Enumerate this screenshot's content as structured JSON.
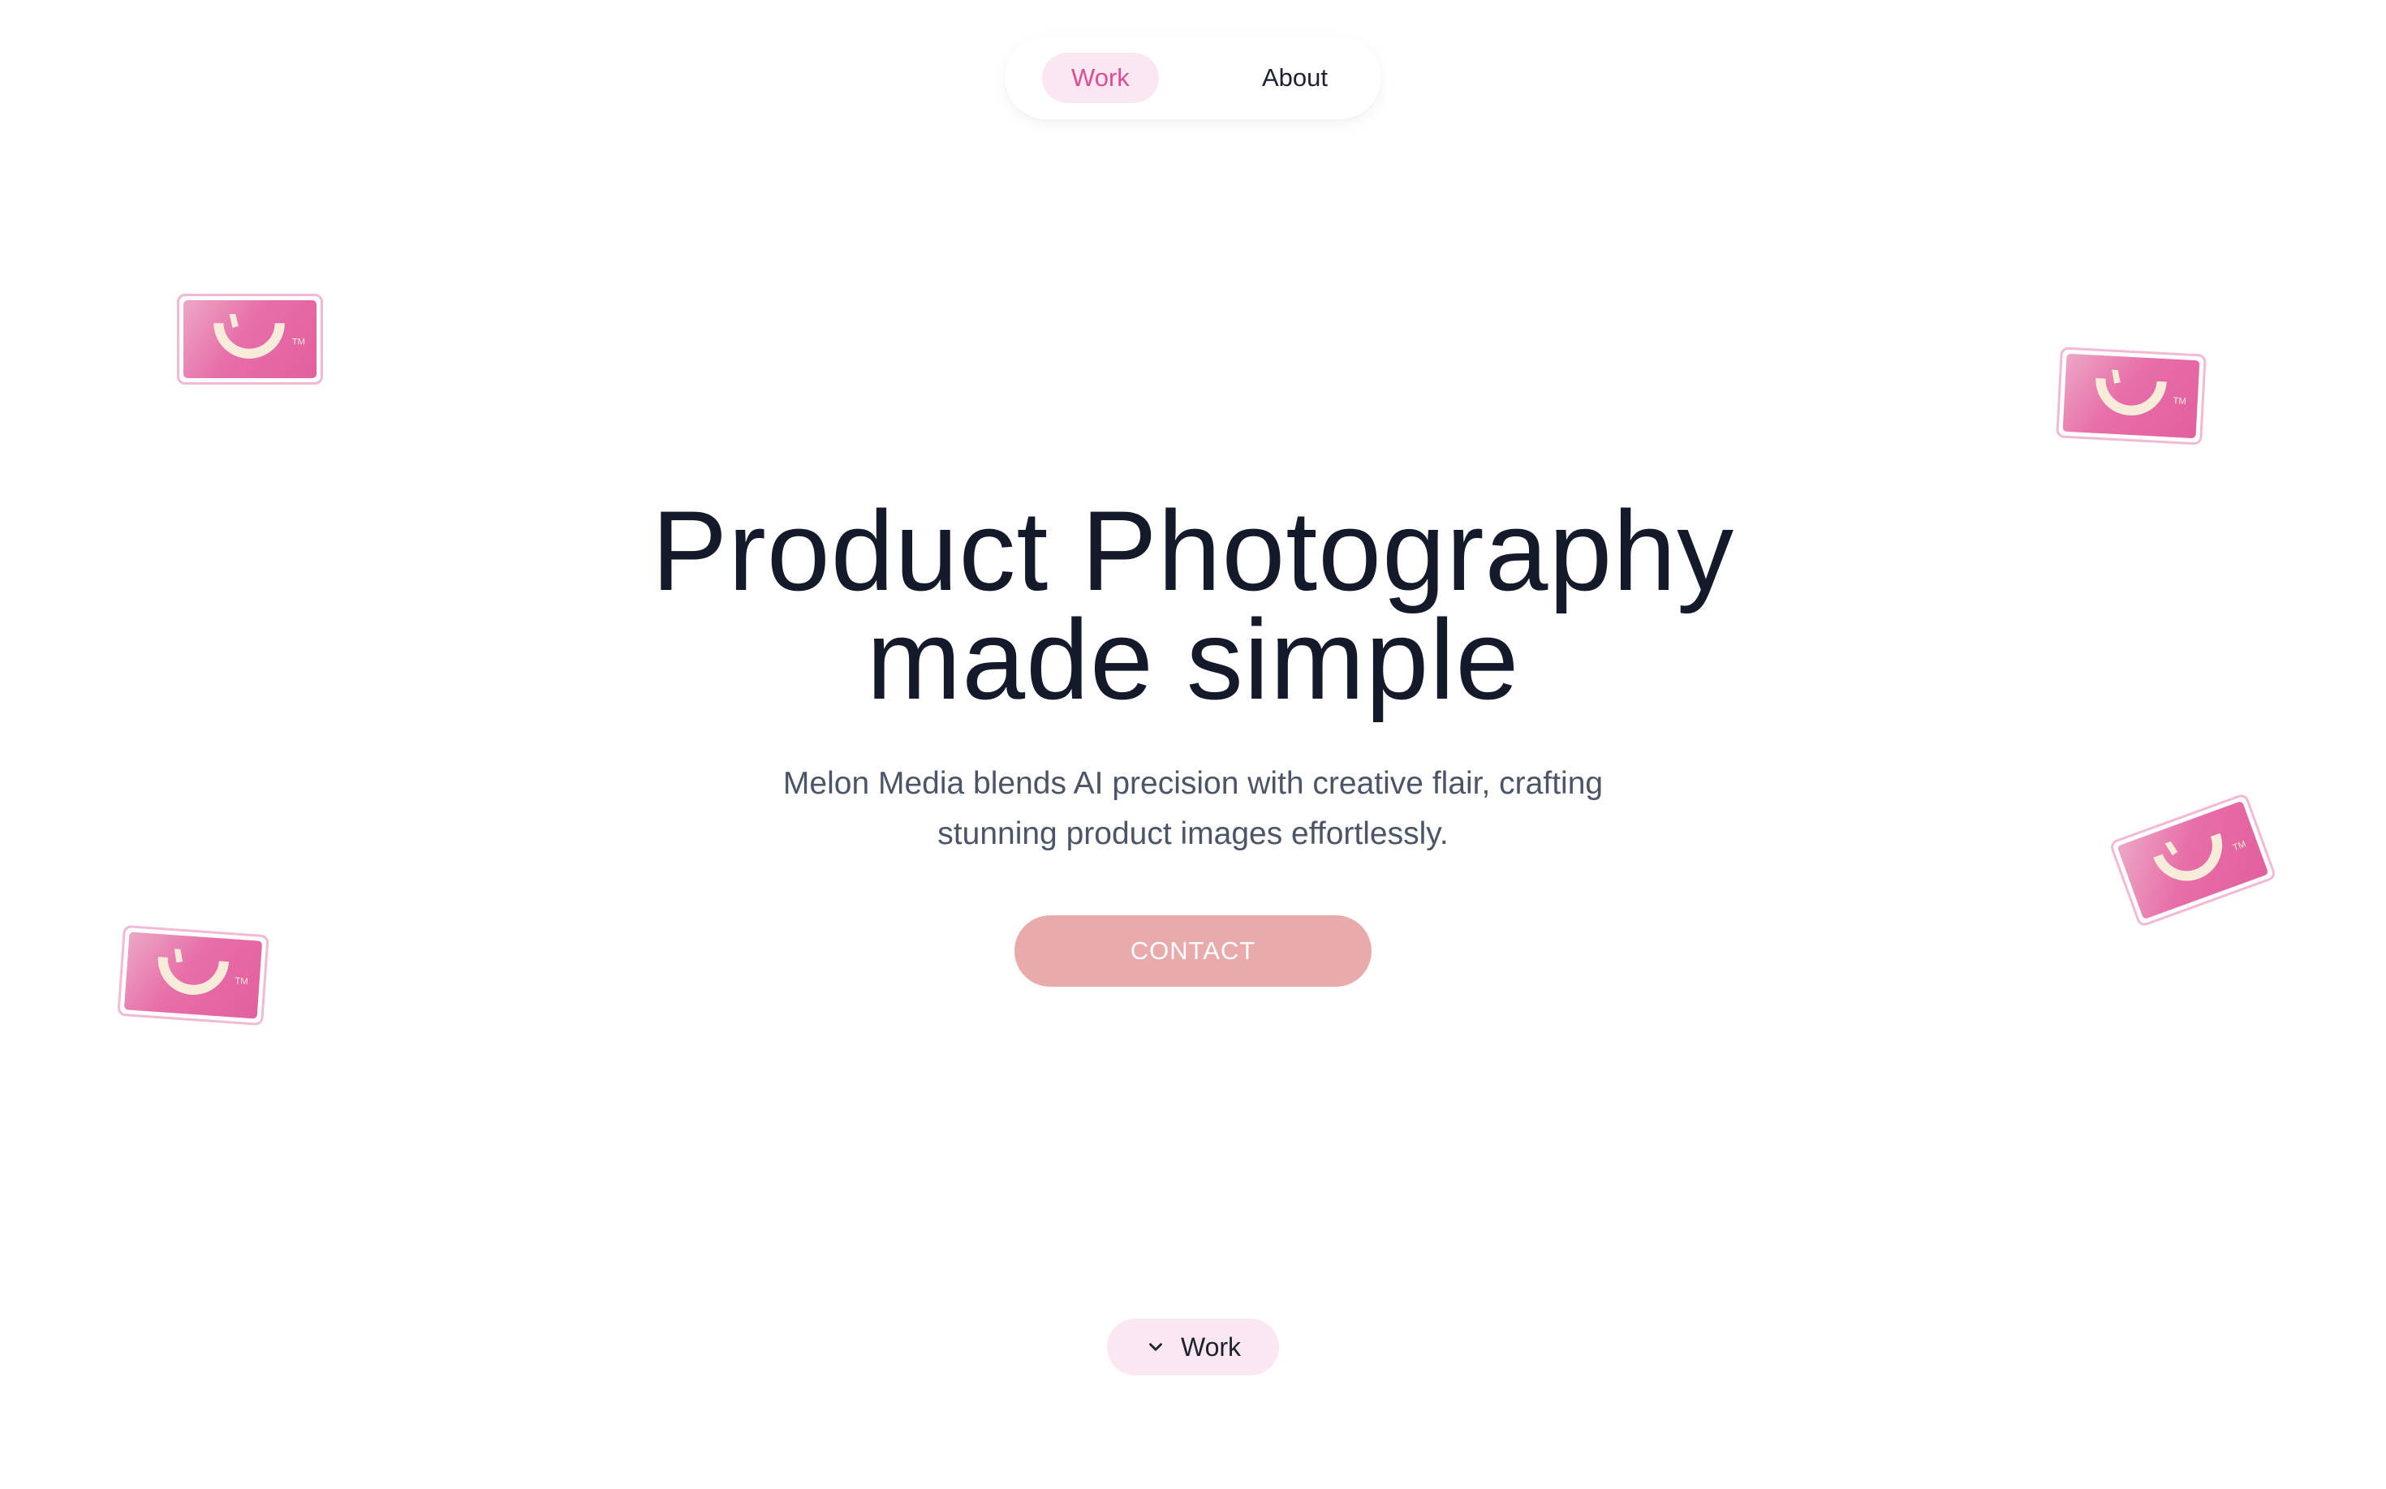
{
  "nav": {
    "items": [
      {
        "label": "Work",
        "active": true
      },
      {
        "label": "About",
        "active": false
      }
    ]
  },
  "hero": {
    "title_line1": "Product Photography",
    "title_line2": "made simple",
    "subtitle_line1": "Melon Media blends AI precision with creative flair, crafting",
    "subtitle_line2": "stunning product images effortlessly.",
    "cta_label": "CONTACT"
  },
  "stickers": {
    "icon": "melon-smile-logo-icon",
    "trademark": "TM",
    "count": 4
  },
  "bottom": {
    "label": "Work",
    "icon": "chevron-down-icon"
  },
  "colors": {
    "accent_pink": "#de4d93",
    "pill_bg": "#fbe7f1",
    "cta_bg": "#e9aaab",
    "heading": "#141a2a",
    "body_text": "#4b5567"
  }
}
